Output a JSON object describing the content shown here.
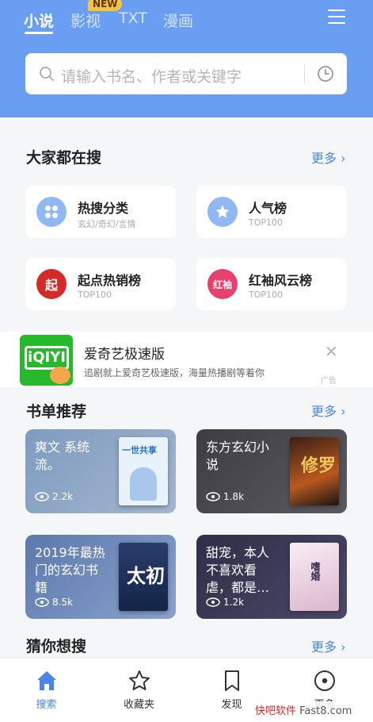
{
  "header": {
    "tabs": [
      {
        "label": "小说",
        "active": true
      },
      {
        "label": "影视",
        "active": false
      },
      {
        "label": "TXT",
        "active": false
      },
      {
        "label": "漫画",
        "active": false
      }
    ],
    "new_badge": "NEW",
    "menu_icon": "menu-icon"
  },
  "search": {
    "placeholder": "请输入书名、作者或关键字",
    "icon": "search-icon",
    "history_icon": "history-icon"
  },
  "popular": {
    "title": "大家都在搜",
    "more": "更多 ›",
    "cards": [
      {
        "title": "热搜分类",
        "subtitle": "玄幻/奇幻/言情",
        "icon": "grid-icon",
        "color": "#8fb8f5"
      },
      {
        "title": "人气榜",
        "subtitle": "TOP100",
        "icon": "star-icon",
        "color": "#8fb8f5"
      },
      {
        "title": "起点热销榜",
        "subtitle": "TOP100",
        "icon": "qidian-icon",
        "glyph": "起",
        "color": "#d42a2a"
      },
      {
        "title": "红袖风云榜",
        "subtitle": "TOP100",
        "icon": "hongxiu-icon",
        "glyph": "红袖",
        "color": "#e8416e"
      }
    ]
  },
  "ad": {
    "logo_text": "iQIYI",
    "title": "爱奇艺极速版",
    "description": "追剧就上爱奇艺极速版，海量热播剧等着你",
    "tag": "广告",
    "close_icon": "close-icon"
  },
  "booklists": {
    "title": "书单推荐",
    "more": "更多 ›",
    "items": [
      {
        "title": "爽文 系统流。",
        "views": "2.2k",
        "bg": "#8fa9c9",
        "cover_text": "一世共享",
        "cover_bg": "#e8f2fb"
      },
      {
        "title": "东方玄幻小说",
        "views": "1.8k",
        "bg": "#4a4a4f",
        "cover_text": "修罗",
        "cover_bg": "#2a1e1a"
      },
      {
        "title": "2019年最热门的玄幻书籍",
        "views": "8.5k",
        "bg": "#6b86b8",
        "cover_text": "太初",
        "cover_bg": "#1d2d52"
      },
      {
        "title": "甜宠，本人不喜欢看虐，都是…",
        "views": "1.2k",
        "bg": "#3a3a55",
        "cover_text": "嗜婚",
        "cover_bg": "#f2e6ef"
      }
    ]
  },
  "guess": {
    "title": "猜你想搜",
    "more": "更多 ›"
  },
  "nav": [
    {
      "label": "搜索",
      "icon": "home-icon",
      "active": true
    },
    {
      "label": "收藏夹",
      "icon": "star-outline-icon",
      "active": false
    },
    {
      "label": "发现",
      "icon": "bookmark-icon",
      "active": false
    },
    {
      "label": "更多",
      "icon": "more-circle-icon",
      "active": false
    }
  ],
  "watermark": {
    "prefix": "快吧软件",
    "suffix": " Fast8.com"
  },
  "colors": {
    "brand": "#6a9ef3",
    "accent": "#4a86e8"
  }
}
